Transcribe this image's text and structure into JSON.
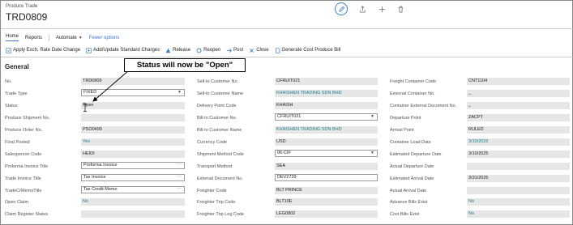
{
  "header": {
    "breadcrumb": "Produce Trade",
    "title": "TRD0809"
  },
  "tabs": [
    {
      "label": "Home"
    },
    {
      "label": "Reports"
    },
    {
      "label": "Automate"
    },
    {
      "label": "Fewer options"
    }
  ],
  "actions": [
    {
      "label": "Apply Exch. Rate Date Change",
      "icon": "apply-icon"
    },
    {
      "label": "Add/Update Standard Charges",
      "icon": "add-update-icon"
    },
    {
      "label": "Release",
      "icon": "release-icon"
    },
    {
      "label": "Reopen",
      "icon": "reopen-icon"
    },
    {
      "label": "Post",
      "icon": "post-icon"
    },
    {
      "label": "Close",
      "icon": "close-icon"
    },
    {
      "label": "Generate Cost Produce Bill",
      "icon": "document-icon"
    }
  ],
  "section": {
    "title": "General"
  },
  "callout": {
    "text": "Status will now be \"Open\""
  },
  "colors": {
    "accent": "#3b7bc6",
    "link": "#1a7d8e",
    "field_bg": "#e6e6e6"
  },
  "col1": [
    {
      "label": "No.",
      "value": "TRD0809"
    },
    {
      "label": "Trade Type",
      "value": "FIXED"
    },
    {
      "label": "Status",
      "value": "Open"
    },
    {
      "label": "Produce Shipment No.",
      "value": ""
    },
    {
      "label": "Produce Order No.",
      "value": "PSO0499"
    },
    {
      "label": "Final Posted",
      "value": "Yes"
    },
    {
      "label": "Salesperson Code",
      "value": "HEIDI"
    },
    {
      "label": "Proforma Invoice Title",
      "value": "Proforma Invoice"
    },
    {
      "label": "Trade Invoice Title",
      "value": "Tax Invoice"
    },
    {
      "label": "TradeCrMemoTitle",
      "value": "Tax Credit Memo"
    },
    {
      "label": "Open Claim",
      "value": "No"
    },
    {
      "label": "Claim Register Status",
      "value": ""
    }
  ],
  "col2": [
    {
      "label": "Sell-to Customer No.",
      "value": "CFRUIT021"
    },
    {
      "label": "Sell-to Customer Name",
      "value": "KHAISHEN TRADING SDN BHD"
    },
    {
      "label": "Delivery Point Code",
      "value": "KHAISH"
    },
    {
      "label": "Bill-to Customer No.",
      "value": "CFRUIT021"
    },
    {
      "label": "Bill-to Customer Name",
      "value": "KHAISHEN TRADING SDN BHD"
    },
    {
      "label": "Currency Code",
      "value": "USD"
    },
    {
      "label": "Shipment Method Code",
      "value": "06-CIF"
    },
    {
      "label": "Transport Method",
      "value": "SEA"
    },
    {
      "label": "External Document No.",
      "value": "DEV2739"
    },
    {
      "label": "Freighter Code",
      "value": "BLT PRINCE"
    },
    {
      "label": "Freighter Trip Code",
      "value": "BLT10E"
    },
    {
      "label": "Freighter Trip Leg Code",
      "value": "LEG0802"
    }
  ],
  "col3": [
    {
      "label": "Freight Container Code",
      "value": "CNT1104"
    },
    {
      "label": "External Container No.",
      "value": "_"
    },
    {
      "label": "Container External Document No.",
      "value": "_"
    },
    {
      "label": "Departure Point",
      "value": "ZACPT"
    },
    {
      "label": "Arrival Point",
      "value": "RULED"
    },
    {
      "label": "Container Load Date",
      "value": "3/10/2025"
    },
    {
      "label": "Estimated Departure Date",
      "value": "3/10/2025"
    },
    {
      "label": "Actual Departure Date",
      "value": ""
    },
    {
      "label": "Estimated Arrival Date",
      "value": "3/31/2025"
    },
    {
      "label": "Actual Arrival Date",
      "value": ""
    },
    {
      "label": "Advance Bills Exist",
      "value": "No"
    },
    {
      "label": "Cost Bills Exist",
      "value": "No"
    }
  ]
}
